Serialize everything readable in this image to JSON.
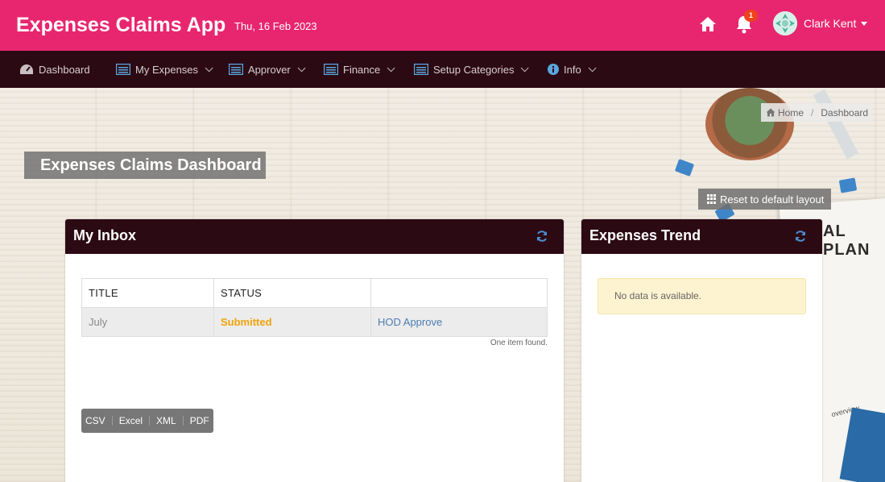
{
  "header": {
    "app_title": "Expenses Claims App",
    "date": "Thu, 16 Feb 2023",
    "notification_count": "1",
    "user_name": "Clark Kent",
    "brand_color": "#e8266f"
  },
  "nav": {
    "items": [
      {
        "label": "Dashboard",
        "icon": "dashboard-icon"
      },
      {
        "label": "My Expenses",
        "icon": "list-icon"
      },
      {
        "label": "Approver",
        "icon": "list-icon"
      },
      {
        "label": "Finance",
        "icon": "list-icon"
      },
      {
        "label": "Setup Categories",
        "icon": "list-icon"
      },
      {
        "label": "Info",
        "icon": "info-icon"
      }
    ],
    "bg_color": "#2c0a14"
  },
  "breadcrumb": {
    "home": "Home",
    "separator": "/",
    "current": "Dashboard"
  },
  "page_title": "Expenses Claims Dashboard",
  "reset_label": "Reset to default layout",
  "background_text": {
    "plan": "AL PLAN",
    "overview": "overview"
  },
  "inbox": {
    "title": "My Inbox",
    "columns": [
      "TITLE",
      "STATUS",
      ""
    ],
    "rows": [
      {
        "title": "July",
        "status": "Submitted",
        "action": "HOD Approve"
      }
    ],
    "found_text": "One item found.",
    "export": [
      "CSV",
      "Excel",
      "XML",
      "PDF"
    ]
  },
  "trend": {
    "title": "Expenses Trend",
    "empty_text": "No data is available."
  }
}
